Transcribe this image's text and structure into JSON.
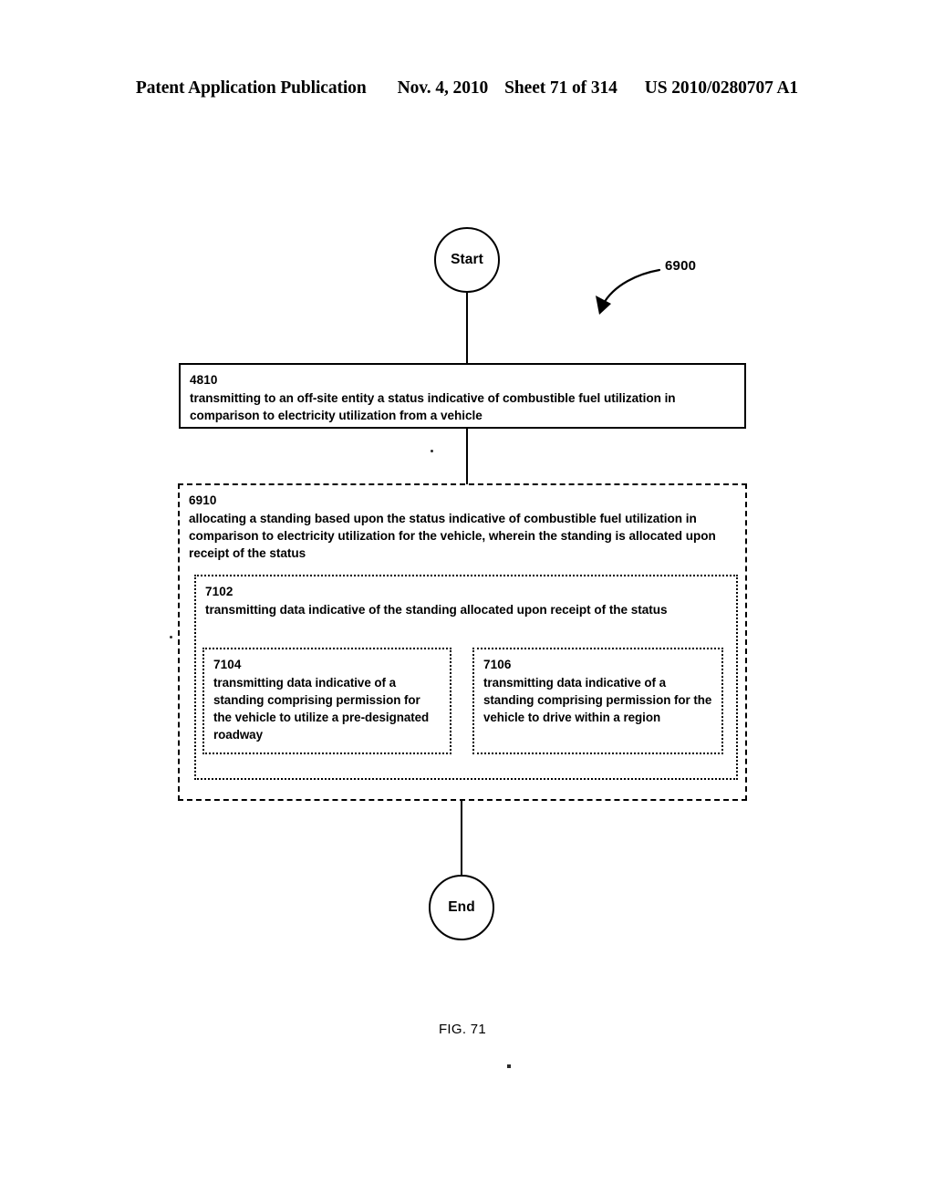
{
  "header": {
    "publication": "Patent Application Publication",
    "date": "Nov. 4, 2010",
    "sheet": "Sheet 71 of 314",
    "patent_number": "US 2010/0280707 A1"
  },
  "figure": {
    "caption": "FIG. 71",
    "leader_label": "6900",
    "start_label": "Start",
    "end_label": "End",
    "nodes": {
      "n4810": {
        "ref": "4810",
        "text": "transmitting to an off-site entity a status indicative of combustible fuel utilization in comparison to electricity utilization from a vehicle"
      },
      "n6910": {
        "ref": "6910",
        "text": "allocating a standing based upon the status indicative of combustible fuel utilization in comparison to electricity utilization for the vehicle, wherein the standing is allocated upon receipt of the status"
      },
      "n7102": {
        "ref": "7102",
        "text": "transmitting data indicative of the standing allocated upon receipt of the status"
      },
      "n7104": {
        "ref": "7104",
        "text": "transmitting data indicative of a standing comprising permission for the vehicle to utilize a pre-designated roadway"
      },
      "n7106": {
        "ref": "7106",
        "text": "transmitting data indicative of a standing comprising permission for the vehicle to drive within a region"
      }
    }
  },
  "colors": {
    "ink": "#000000",
    "paper": "#ffffff"
  }
}
